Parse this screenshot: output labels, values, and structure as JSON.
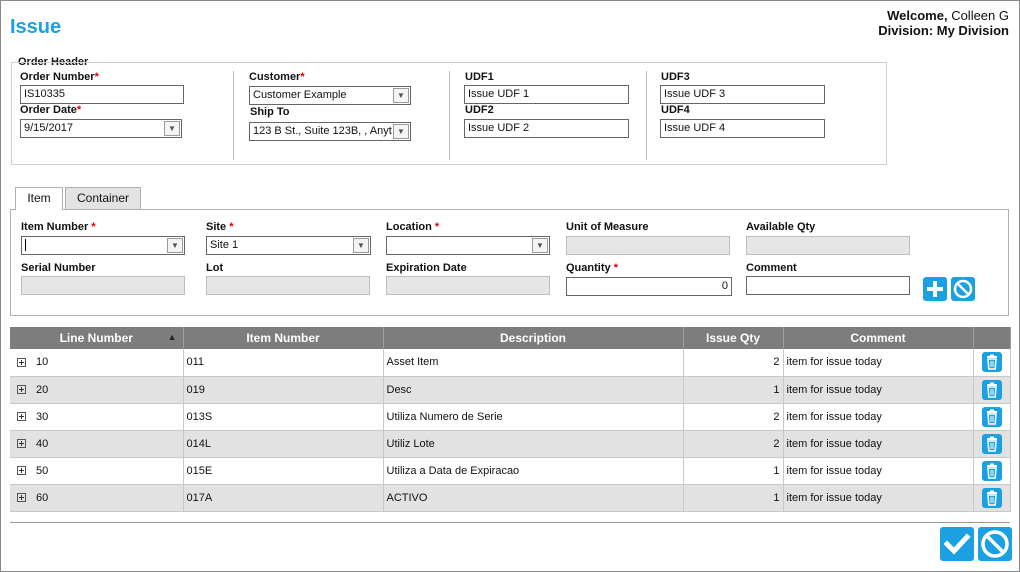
{
  "page": {
    "title": "Issue"
  },
  "user": {
    "welcome_prefix": "Welcome,",
    "name": "Colleen G",
    "division": "Division: My Division"
  },
  "order_header": {
    "legend": "Order Header",
    "order_number": {
      "label": "Order Number",
      "value": "IS10335"
    },
    "order_date": {
      "label": "Order Date",
      "value": "9/15/2017"
    },
    "customer": {
      "label": "Customer",
      "value": "Customer Example"
    },
    "ship_to": {
      "label": "Ship To",
      "value": "123 B St., Suite 123B, , Anyt"
    },
    "udf1": {
      "label": "UDF1",
      "value": "Issue UDF 1"
    },
    "udf2": {
      "label": "UDF2",
      "value": "Issue UDF 2"
    },
    "udf3": {
      "label": "UDF3",
      "value": "Issue UDF 3"
    },
    "udf4": {
      "label": "UDF4",
      "value": "Issue UDF 4"
    }
  },
  "tabs": [
    {
      "label": "Item",
      "active": true
    },
    {
      "label": "Container",
      "active": false
    }
  ],
  "item_form": {
    "item_number": {
      "label": "Item Number",
      "value": ""
    },
    "site": {
      "label": "Site",
      "value": "Site 1"
    },
    "location": {
      "label": "Location",
      "value": ""
    },
    "unit_of_measure": {
      "label": "Unit of Measure",
      "value": ""
    },
    "available_qty": {
      "label": "Available Qty",
      "value": ""
    },
    "serial_number": {
      "label": "Serial Number",
      "value": ""
    },
    "lot": {
      "label": "Lot",
      "value": ""
    },
    "expiration_date": {
      "label": "Expiration Date",
      "value": ""
    },
    "quantity": {
      "label": "Quantity",
      "value": "0"
    },
    "comment": {
      "label": "Comment",
      "value": ""
    },
    "required_marker": "*",
    "add_icon": "plus-icon",
    "cancel_icon": "cancel-circle-icon"
  },
  "grid": {
    "columns": [
      "Line Number",
      "Item Number",
      "Description",
      "Issue Qty",
      "Comment"
    ],
    "sort_indicator": "▲",
    "rows": [
      {
        "line": "10",
        "item": "011",
        "description": "Asset Item",
        "qty": "2",
        "comment": "item for issue today"
      },
      {
        "line": "20",
        "item": "019",
        "description": "Desc",
        "qty": "1",
        "comment": "item for issue today"
      },
      {
        "line": "30",
        "item": "013S",
        "description": "Utiliza Numero de Serie",
        "qty": "2",
        "comment": "item for issue today"
      },
      {
        "line": "40",
        "item": "014L",
        "description": "Utiliz Lote",
        "qty": "2",
        "comment": "item for issue today"
      },
      {
        "line": "50",
        "item": "015E",
        "description": "Utiliza a Data de Expiracao",
        "qty": "1",
        "comment": "item for issue today"
      },
      {
        "line": "60",
        "item": "017A",
        "description": "ACTIVO",
        "qty": "1",
        "comment": "item for issue today"
      }
    ],
    "row_action_icon": "trash-icon"
  },
  "footer": {
    "save_icon": "checkmark-icon",
    "cancel_icon": "cancel-circle-icon"
  },
  "colors": {
    "accent": "#1ba1e2",
    "header_bg": "#7d7d7d",
    "required": "#dd0000"
  }
}
